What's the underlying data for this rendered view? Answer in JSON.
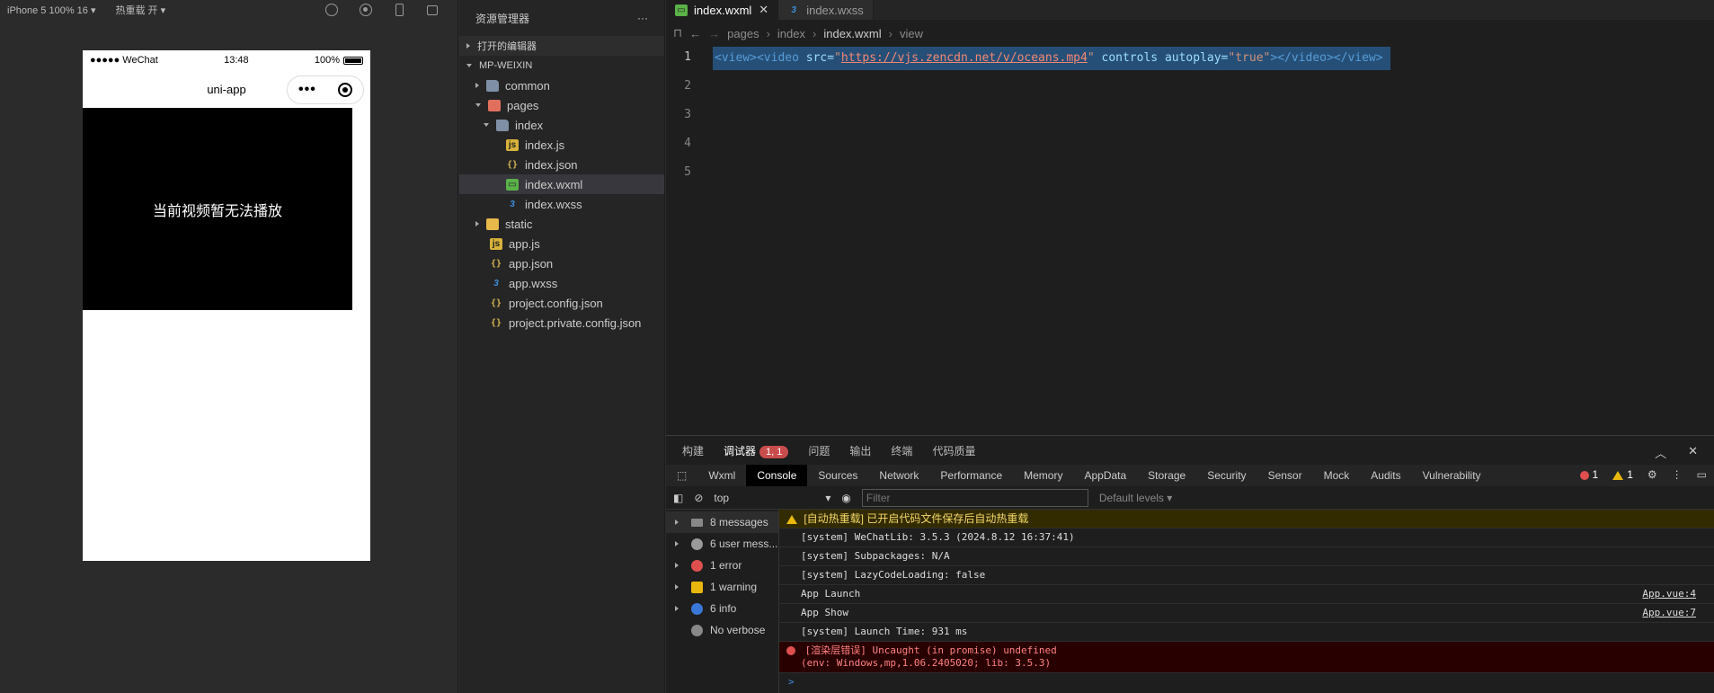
{
  "simulator": {
    "device": "iPhone 5 100% 16",
    "hot_reload": "热重载 开",
    "status_left": "●●●●● WeChat",
    "status_time": "13:48",
    "status_battery": "100%",
    "nav_title": "uni-app",
    "video_message": "当前视频暂无法播放"
  },
  "explorer": {
    "title": "资源管理器",
    "more": "···",
    "open_editors": "打开的编辑器",
    "project": "MP-WEIXIN",
    "tree": [
      {
        "name": "common",
        "type": "folder"
      },
      {
        "name": "pages",
        "type": "folder-red"
      },
      {
        "name": "index",
        "type": "folder"
      },
      {
        "name": "index.js",
        "type": "js"
      },
      {
        "name": "index.json",
        "type": "json"
      },
      {
        "name": "index.wxml",
        "type": "wxml"
      },
      {
        "name": "index.wxss",
        "type": "css"
      },
      {
        "name": "static",
        "type": "folder-yel"
      },
      {
        "name": "app.js",
        "type": "js"
      },
      {
        "name": "app.json",
        "type": "json"
      },
      {
        "name": "app.wxss",
        "type": "css"
      },
      {
        "name": "project.config.json",
        "type": "json"
      },
      {
        "name": "project.private.config.json",
        "type": "json"
      }
    ]
  },
  "editor": {
    "tabs": [
      "index.wxml",
      "index.wxss"
    ],
    "breadcrumb": [
      "pages",
      "index",
      "index.wxml",
      "view"
    ],
    "line_numbers": [
      "1",
      "2",
      "3",
      "4",
      "5"
    ],
    "code": {
      "t1": "<view>",
      "t2": "<video",
      "a1": " src=",
      "s1": "\"",
      "url": "https://vjs.zencdn.net/v/oceans.mp4",
      "s2": "\"",
      "a2": " controls autoplay=",
      "s3": "\"true\"",
      "t3": "></video></view>"
    }
  },
  "panel": {
    "tabs": [
      "构建",
      "调试器",
      "问题",
      "输出",
      "终端",
      "代码质量"
    ],
    "debugger_badge": "1, 1",
    "devtabs": [
      "Wxml",
      "Console",
      "Sources",
      "Network",
      "Performance",
      "Memory",
      "AppData",
      "Storage",
      "Security",
      "Sensor",
      "Mock",
      "Audits",
      "Vulnerability"
    ],
    "error_count": "1",
    "warning_count": "1",
    "context": "top",
    "filter_placeholder": "Filter",
    "levels": "Default levels",
    "sidebar": [
      {
        "label": "8 messages",
        "color": "#888888"
      },
      {
        "label": "6 user mess...",
        "color": "#9a9a9a"
      },
      {
        "label": "1 error",
        "color": "#e04f4f"
      },
      {
        "label": "1 warning",
        "color": "#e8b80f"
      },
      {
        "label": "6 info",
        "color": "#3a78d8"
      },
      {
        "label": "No verbose",
        "color": "#888888"
      }
    ],
    "messages": {
      "m0": "[自动热重载] 已开启代码文件保存后自动热重载",
      "m1": "[system] WeChatLib: 3.5.3 (2024.8.12 16:37:41)",
      "m2": "[system] Subpackages: N/A",
      "m3": "[system] LazyCodeLoading: false",
      "m4": "App Launch",
      "m4_src": "App.vue:4",
      "m5": "App Show",
      "m5_src": "App.vue:7",
      "m6": "[system] Launch Time: 931 ms",
      "m7a": "[渲染层错误] Uncaught (in promise) undefined",
      "m7b": "(env: Windows,mp,1.06.2405020; lib: 3.5.3)"
    },
    "prompt": ">"
  }
}
